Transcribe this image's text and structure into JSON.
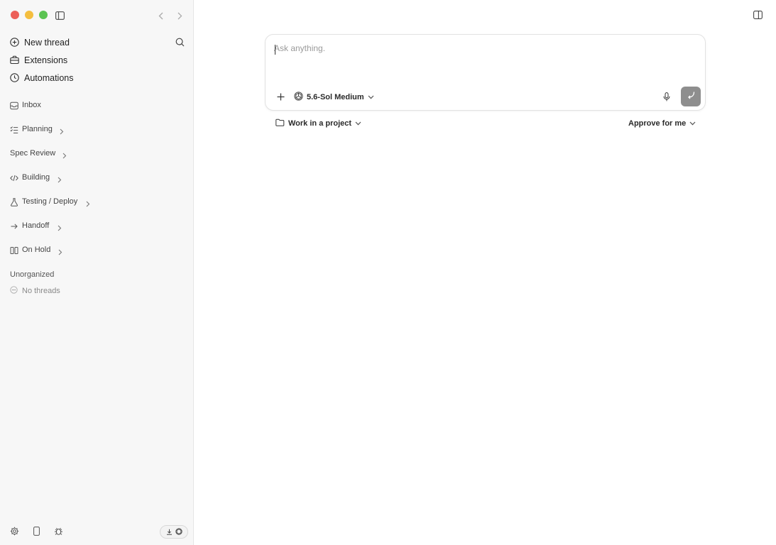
{
  "colors": {
    "close": "#ec5f58",
    "minimize": "#f4be3f",
    "zoom": "#5bc452",
    "send": "#8e8e8e"
  },
  "sidebar": {
    "primary": [
      {
        "label": "New thread",
        "icon": "plus-circle-icon"
      },
      {
        "label": "Extensions",
        "icon": "toolbox-icon"
      },
      {
        "label": "Automations",
        "icon": "clock-icon"
      }
    ],
    "groups": [
      {
        "label": "Inbox",
        "icon": "inbox-icon",
        "chevron": false
      },
      {
        "label": "Planning",
        "icon": "checklist-icon",
        "chevron": true
      },
      {
        "label": "Spec Review",
        "icon": "",
        "chevron": true
      },
      {
        "label": "Building",
        "icon": "code-icon",
        "chevron": true
      },
      {
        "label": "Testing / Deploy",
        "icon": "flask-icon",
        "chevron": true
      },
      {
        "label": "Handoff",
        "icon": "arrow-right-icon",
        "chevron": true
      },
      {
        "label": "On Hold",
        "icon": "columns-icon",
        "chevron": true
      }
    ],
    "unorganized": {
      "label": "Unorganized",
      "empty_label": "No threads"
    },
    "bottom_icons": [
      "gear-icon",
      "phone-icon",
      "bug-icon"
    ]
  },
  "composer": {
    "placeholder": "Ask anything.",
    "model": "5.6-Sol Medium"
  },
  "below": {
    "project_label": "Work in a project",
    "approve_label": "Approve for me"
  }
}
